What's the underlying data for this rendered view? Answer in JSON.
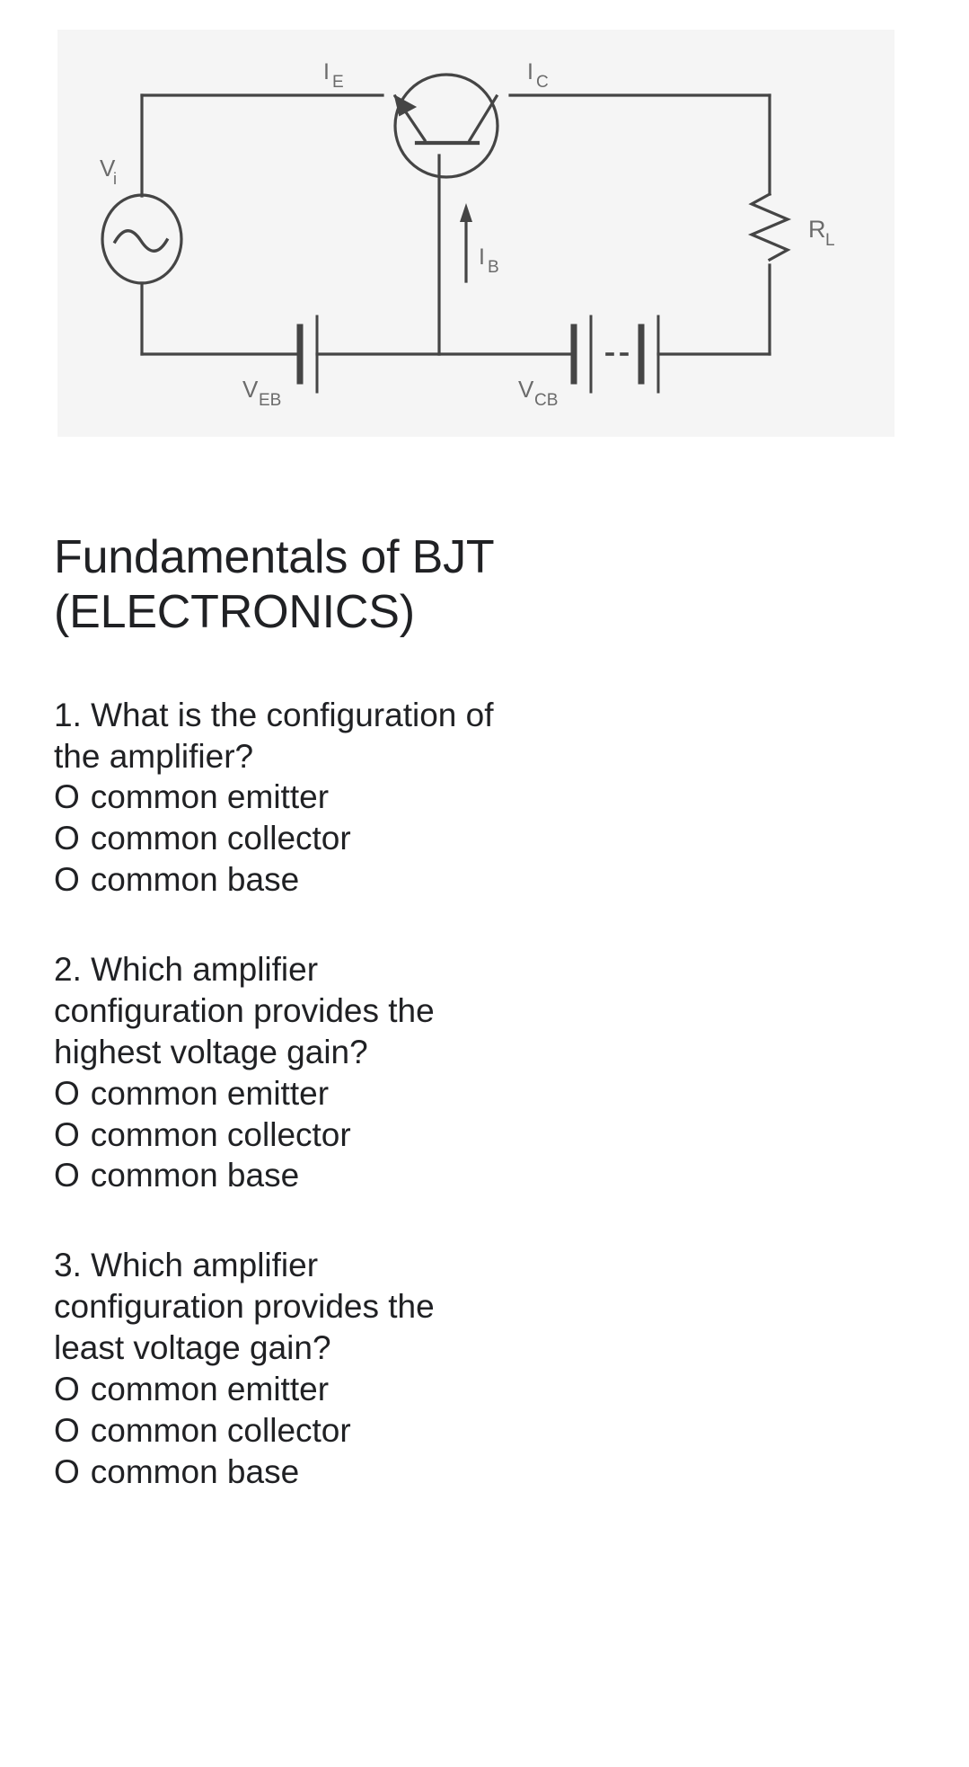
{
  "figure": {
    "name": "common-base-bjt-amplifier-circuit",
    "background_color": "#f5f5f5",
    "stroke_color": "#3c3c3c",
    "labels": {
      "source": "V",
      "source_sub": "i",
      "emitter_current": "I",
      "emitter_current_sub": "E",
      "collector_current": "I",
      "collector_current_sub": "C",
      "base_current": "I",
      "base_current_sub": "B",
      "load_resistor": "R",
      "load_resistor_sub": "L",
      "emitter_base_supply": "V",
      "emitter_base_supply_sub": "EB",
      "collector_base_supply": "V",
      "collector_base_supply_sub": "CB"
    }
  },
  "page_title": "Fundamentals of BJT\n(ELECTRONICS)",
  "option_marker": "O",
  "questions": [
    {
      "text": "1. What is the configuration of\nthe amplifier?",
      "options": [
        "common emitter",
        "common collector",
        "common base"
      ]
    },
    {
      "text": "2. Which amplifier\nconfiguration provides the\nhighest voltage gain?",
      "options": [
        "common emitter",
        "common collector",
        "common base"
      ]
    },
    {
      "text": "3. Which amplifier\nconfiguration provides the\nleast voltage gain?",
      "options": [
        "common emitter",
        "common collector",
        "common base"
      ]
    }
  ]
}
